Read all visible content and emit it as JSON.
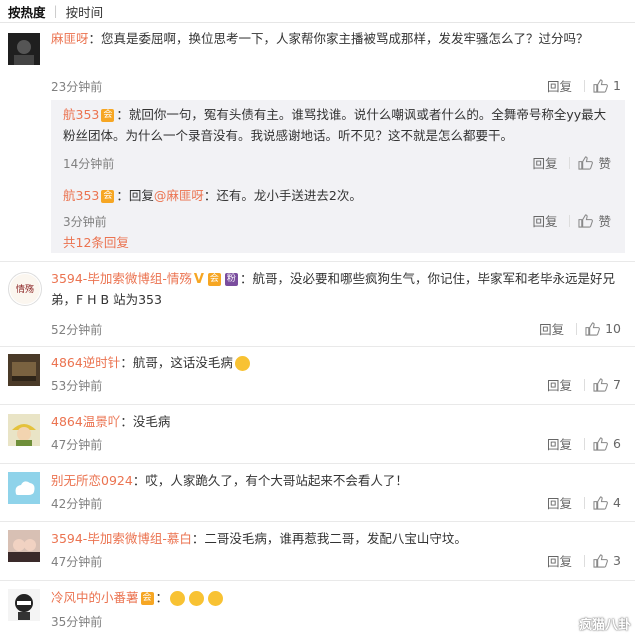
{
  "tabs": [
    "按热度",
    "按时间"
  ],
  "actions": {
    "reply": "回复",
    "like": "赞"
  },
  "comments": [
    {
      "username": "麻匪呀",
      "text": "：您真是委屈啊，换位思考一下，人家帮你家主播被骂成那样，发发牢骚怎么了？过分吗？",
      "time": "23分钟前",
      "likes": "1",
      "replies": [
        {
          "username": "航353",
          "badges": [
            "vip"
          ],
          "text": "：就回你一句，冤有头债有主。谁骂找谁。说什么嘲讽或者什么的。全舞帝号称全yy最大粉丝团体。为什么一个录音没有。我说感谢地话。听不见？这不就是怎么都要干。",
          "time": "14分钟前",
          "likes": "赞"
        },
        {
          "username": "航353",
          "badges": [
            "vip"
          ],
          "reply_to": "@麻匪呀",
          "text": "：还有。龙小手送进去2次。",
          "text_prefix": "：回复",
          "time": "3分钟前",
          "likes": "赞"
        }
      ],
      "more_replies": "共12条回复"
    },
    {
      "username": "3594-毕加索微博组-情殇",
      "badges": [
        "V",
        "vip",
        "fan"
      ],
      "text": "：航哥，没必要和哪些疯狗生气，你记住，毕家军和老毕永远是好兄弟，F H B 站为353",
      "time": "52分钟前",
      "likes": "10"
    },
    {
      "username": "4864逆时针",
      "text": "：航哥，这话没毛病",
      "emoji": true,
      "time": "53分钟前",
      "likes": "7"
    },
    {
      "username": "4864温景吖",
      "text": "：没毛病",
      "time": "47分钟前",
      "likes": "6"
    },
    {
      "username": "别无所恋0924",
      "text": "：哎，人家跪久了，有个大哥站起来不会看人了！",
      "time": "42分钟前",
      "likes": "4"
    },
    {
      "username": "3594-毕加索微博组-慕白",
      "text": "：二哥没毛病，谁再惹我二哥，发配八宝山守坟。",
      "time": "47分钟前",
      "likes": "3"
    },
    {
      "username": "冷风中的小番薯",
      "badges": [
        "vip"
      ],
      "text": "：",
      "time": "35分钟前",
      "likes": ""
    }
  ],
  "badge_labels": {
    "V": "V",
    "vip": "会",
    "fan": "粉"
  },
  "colors": {
    "username": "#eb7350",
    "meta": "#808080",
    "reply_bg": "#f2f2f5"
  },
  "watermark": "疯猫八卦",
  "icons": [
    "thumb-up-icon",
    "avatar",
    "emoji-icon"
  ]
}
